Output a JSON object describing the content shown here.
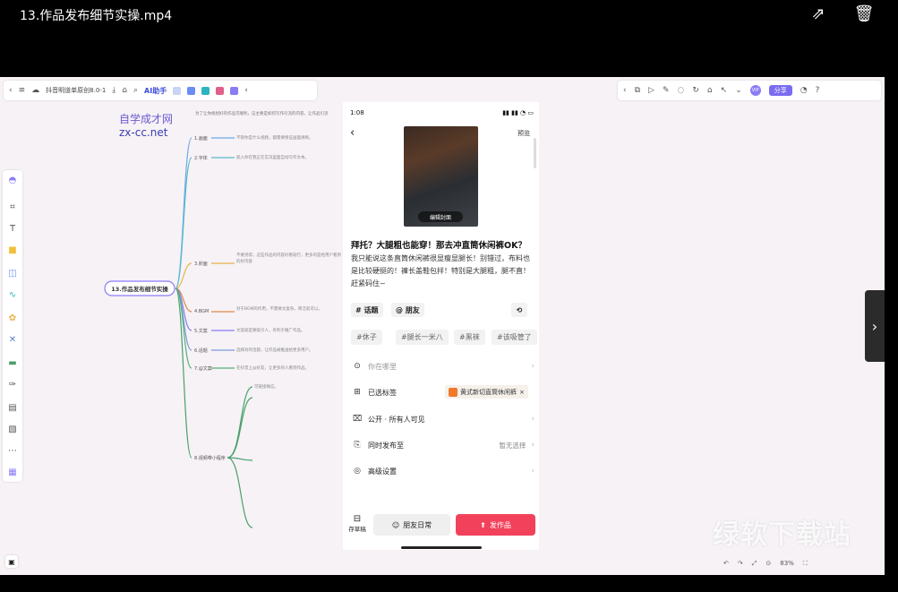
{
  "window": {
    "title": "13.作品发布细节实操.mp4"
  },
  "toolbar_icons": [
    "external-link-icon",
    "trash-icon"
  ],
  "mindmap_app": {
    "doc_title": "抖音明道单原创8.0-1",
    "ai_label": "AI助手",
    "share_label": "分享",
    "zoom": "83%"
  },
  "watermark": {
    "line1": "自学成才网",
    "line2": "zx-cc.net",
    "brand": "绿软下载站"
  },
  "mindmap": {
    "root": "13.作品发布细节实操",
    "top_note": "为了让你规划好的作品可顺利，这主要是如何写作引流的内容，让作品引流",
    "branches": [
      {
        "label": "1.画面",
        "note": "不管你是什么视频，都需要保证画面清晰。"
      },
      {
        "label": "2.字体",
        "note": "嵌入你在我正在实况里面自动写作文本。"
      },
      {
        "label": "3.封面",
        "note": "不要觉得，这些作品的内容好看就行，更多的是给用户看到的好内容"
      },
      {
        "label": "4.BGM",
        "note": "对于BGM的作用，不需要太复杂，简洁就可以。"
      },
      {
        "label": "5.文案",
        "note": "文案就是要吸引人，有利于推广作品。"
      },
      {
        "label": "6.话题",
        "note": "选择对的话题，让作品被推送给更多用户。"
      },
      {
        "label": "7.@文案",
        "note": "在抖音上@好友，让更多的人看到作品。"
      },
      {
        "label": "8.视频带小程序",
        "note": "可链接微信。"
      }
    ]
  },
  "phone": {
    "status_time": "1:08",
    "preview_label": "预览",
    "cover_tag": "编辑封面",
    "post_title": "拜托？大腿粗也能穿！那去冲直筒休闲裤OK？",
    "post_body": "我只能说这条直筒休闲裤很显瘦显腿长！别错过，布料也是比较硬挺的！褲长盖鞋包拌！特别是大腿粗，腿不直！赶紧码住~",
    "chips": [
      "# 话题",
      "@ 朋友"
    ],
    "tags": [
      "#休子",
      "#腿长一米八",
      "#黑袜",
      "#该吸管了"
    ],
    "rows": [
      {
        "icon": "location-icon",
        "label": "你在哪里",
        "value": ""
      },
      {
        "icon": "grid-icon",
        "label": "已选标签",
        "value": ""
      },
      {
        "icon": "lock-icon",
        "label": "公开 · 所有人可见",
        "value": ""
      },
      {
        "icon": "sync-icon",
        "label": "同时发布至",
        "value": "暂无选择"
      },
      {
        "icon": "settings-icon",
        "label": "高级设置",
        "value": ""
      }
    ],
    "selected_tag": "黄式新切直筒休闲裤",
    "draft_label": "存草稿",
    "friend_label": "朋友日常",
    "publish_label": "发作品"
  }
}
